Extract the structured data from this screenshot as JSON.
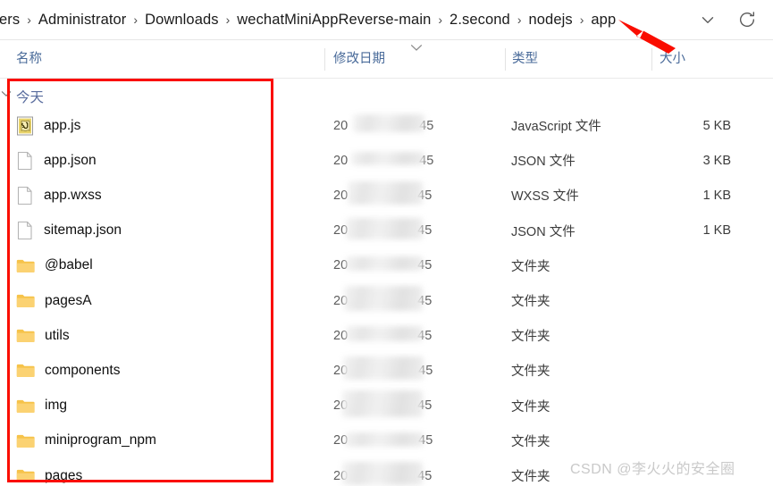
{
  "window": {
    "type": "file-explorer"
  },
  "addressbar": {
    "crumbs": [
      "ers",
      "Administrator",
      "Downloads",
      "wechatMiniAppReverse-main",
      "2.second",
      "nodejs",
      "app"
    ],
    "separator": "›",
    "dropdown_icon": "chevron-down-icon",
    "refresh_icon": "refresh-icon"
  },
  "columns": {
    "name": "名称",
    "date_modified": "修改日期",
    "type": "类型",
    "size": "大小",
    "sort_indicator": "chevron-down-icon"
  },
  "group": {
    "label": "今天",
    "expand_icon": "chevron-down-icon"
  },
  "files": [
    {
      "name": "app.js",
      "icon": "javascript-file-icon",
      "date_prefix": "20",
      "date_suffix": "45",
      "type": "JavaScript 文件",
      "size": "5 KB"
    },
    {
      "name": "app.json",
      "icon": "generic-file-icon",
      "date_prefix": "20",
      "date_suffix": "45",
      "type": "JSON 文件",
      "size": "3 KB"
    },
    {
      "name": "app.wxss",
      "icon": "generic-file-icon",
      "date_prefix": "20",
      "date_suffix": "45",
      "type": "WXSS 文件",
      "size": "1 KB"
    },
    {
      "name": "sitemap.json",
      "icon": "generic-file-icon",
      "date_prefix": "20",
      "date_suffix": "45",
      "type": "JSON 文件",
      "size": "1 KB"
    },
    {
      "name": "@babel",
      "icon": "folder-icon",
      "date_prefix": "20",
      "date_suffix": "45",
      "type": "文件夹",
      "size": ""
    },
    {
      "name": "pagesA",
      "icon": "folder-icon",
      "date_prefix": "20",
      "date_suffix": "45",
      "type": "文件夹",
      "size": ""
    },
    {
      "name": "utils",
      "icon": "folder-icon",
      "date_prefix": "20",
      "date_suffix": "45",
      "type": "文件夹",
      "size": ""
    },
    {
      "name": "components",
      "icon": "folder-icon",
      "date_prefix": "20",
      "date_suffix": "45",
      "type": "文件夹",
      "size": ""
    },
    {
      "name": "img",
      "icon": "folder-icon",
      "date_prefix": "20",
      "date_suffix": "45",
      "type": "文件夹",
      "size": ""
    },
    {
      "name": "miniprogram_npm",
      "icon": "folder-icon",
      "date_prefix": "20",
      "date_suffix": "45",
      "type": "文件夹",
      "size": ""
    },
    {
      "name": "pages",
      "icon": "folder-icon",
      "date_prefix": "20",
      "date_suffix": "45",
      "type": "文件夹",
      "size": ""
    }
  ],
  "annotations": {
    "highlight_box_color": "#fa0d00",
    "arrow_color": "#fa0d00",
    "arrow_target": "app"
  },
  "watermark": {
    "text": "CSDN @李火火的安全圈",
    "color": "#c9c9c9"
  }
}
